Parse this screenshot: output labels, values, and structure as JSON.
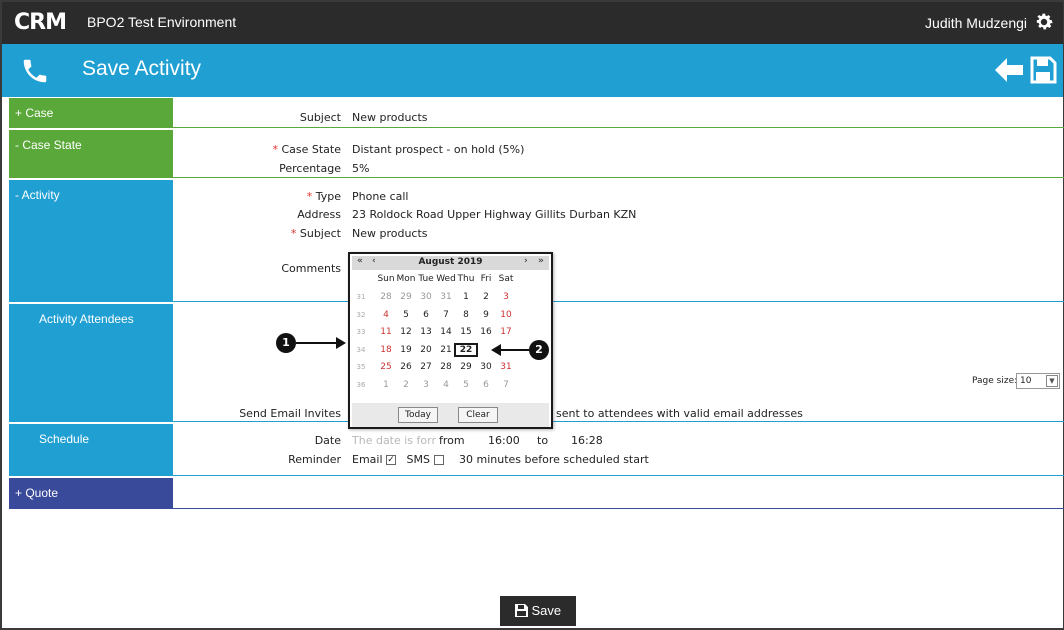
{
  "app": {
    "logo": "CRM",
    "environment": "BPO2 Test Environment",
    "user": "Judith Mudzengi"
  },
  "header": {
    "title": "Save Activity"
  },
  "sections": {
    "case": {
      "label": "+ Case",
      "subject_label": "Subject",
      "subject_value": "New products"
    },
    "case_state": {
      "label": "- Case State",
      "state_label": "Case State",
      "state_value": "Distant prospect - on hold (5%)",
      "pct_label": "Percentage",
      "pct_value": "5%"
    },
    "activity": {
      "label": "- Activity",
      "type_label": "Type",
      "type_value": "Phone call",
      "address_label": "Address",
      "address_value": "23 Roldock Road Upper Highway Gillits Durban KZN",
      "subject_label": "Subject",
      "subject_value": "New products",
      "comments_label": "Comments"
    },
    "attendees": {
      "label": "Activity Attendees",
      "send_label": "Send Email Invites",
      "send_text": "sent to attendees with valid email addresses",
      "page_size_label": "Page size:",
      "page_size_value": "10"
    },
    "schedule": {
      "label": "Schedule",
      "date_label": "Date",
      "date_placeholder": "The date is forr",
      "from_label": "from",
      "from_value": "16:00",
      "to_label": "to",
      "to_value": "16:28",
      "reminder_label": "Reminder",
      "email_label": "Email",
      "sms_label": "SMS",
      "before_text": "30 minutes before scheduled start"
    },
    "quote": {
      "label": "+ Quote"
    }
  },
  "calendar": {
    "prev_year": "«",
    "prev_month": "‹",
    "next_month": "›",
    "next_year": "»",
    "month": "August 2019",
    "weekdays": [
      "Sun",
      "Mon",
      "Tue",
      "Wed",
      "Thu",
      "Fri",
      "Sat"
    ],
    "weeks": [
      {
        "wk": "31",
        "days": [
          "28",
          "29",
          "30",
          "31",
          "1",
          "2",
          "3"
        ]
      },
      {
        "wk": "32",
        "days": [
          "4",
          "5",
          "6",
          "7",
          "8",
          "9",
          "10"
        ]
      },
      {
        "wk": "33",
        "days": [
          "11",
          "12",
          "13",
          "14",
          "15",
          "16",
          "17"
        ]
      },
      {
        "wk": "34",
        "days": [
          "18",
          "19",
          "20",
          "21",
          "22",
          "",
          ""
        ]
      },
      {
        "wk": "35",
        "days": [
          "25",
          "26",
          "27",
          "28",
          "29",
          "30",
          "31"
        ]
      },
      {
        "wk": "36",
        "days": [
          "1",
          "2",
          "3",
          "4",
          "5",
          "6",
          "7"
        ]
      }
    ],
    "selected": "22",
    "today_label": "Today",
    "clear_label": "Clear"
  },
  "markers": {
    "one": "1",
    "two": "2"
  },
  "footer": {
    "save_label": "Save"
  },
  "colors": {
    "green": "#5ba83a",
    "blue": "#1f9fd2",
    "navy": "#3a4a9a",
    "dark": "#2b2b2b"
  }
}
